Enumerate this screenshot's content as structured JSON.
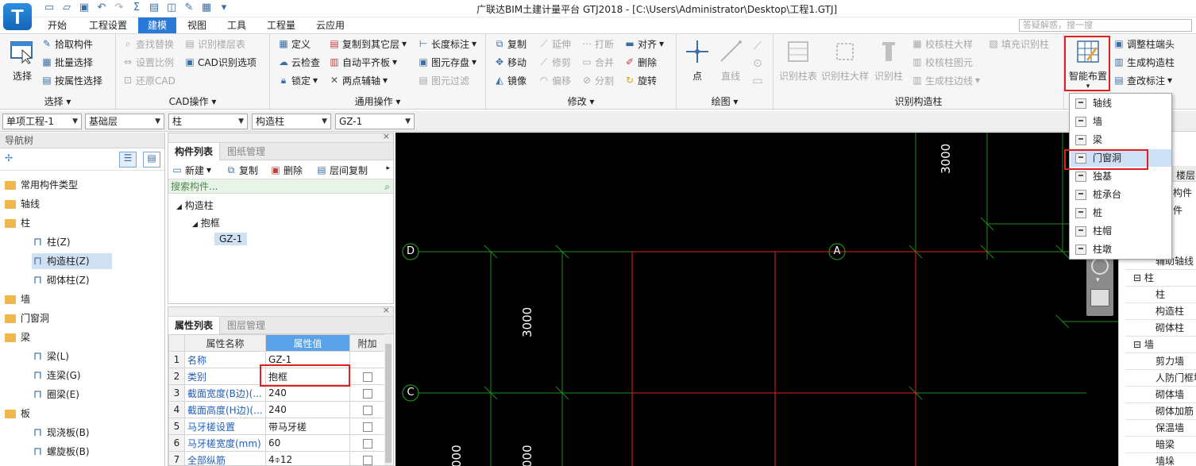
{
  "app": {
    "logo_letter": "T",
    "title": "广联达BIM土建计量平台 GTJ2018 - [C:\\Users\\Administrator\\Desktop\\工程1.GTJ]",
    "help_placeholder": "答疑解惑，搜一搜"
  },
  "tabs": [
    "开始",
    "工程设置",
    "建模",
    "视图",
    "工具",
    "工程量",
    "云应用"
  ],
  "active_tab": "建模",
  "ribbon": {
    "select": {
      "big_label": "选择",
      "items": [
        "拾取构件",
        "批量选择",
        "按属性选择"
      ],
      "group_label": "选择"
    },
    "cad": {
      "items": [
        "查找替换",
        "识别楼层表",
        "设置比例",
        "CAD识别选项",
        "还原CAD"
      ],
      "group_label": "CAD操作"
    },
    "general": {
      "items": [
        "定义",
        "复制到其它层",
        "长度标注",
        "云检查",
        "自动平齐板",
        "图元存盘",
        "锁定",
        "两点辅轴",
        "图元过滤"
      ],
      "group_label": "通用操作"
    },
    "modify": {
      "items": [
        "复制",
        "延伸",
        "打断",
        "对齐",
        "移动",
        "修剪",
        "合并",
        "删除",
        "镜像",
        "偏移",
        "分割",
        "旋转"
      ],
      "group_label": "修改"
    },
    "draw": {
      "items": [
        "点",
        "直线"
      ],
      "group_label": "绘图"
    },
    "recognize": {
      "items": [
        "识别柱表",
        "识别柱大样",
        "识别柱",
        "校核柱大样",
        "校核柱图元",
        "生成柱边线",
        "填充识别柱"
      ],
      "group_label": "识别构造柱"
    },
    "smart": {
      "big_label": "智能布置",
      "items": [
        "调整柱端头",
        "生成构造柱",
        "查改标注"
      ]
    }
  },
  "selectors": [
    "单项工程-1",
    "基础层",
    "柱",
    "构造柱",
    "GZ-1"
  ],
  "nav": {
    "header": "导航树",
    "items": [
      {
        "label": "常用构件类型",
        "level": 0
      },
      {
        "label": "轴线",
        "level": 0
      },
      {
        "label": "柱",
        "level": 0
      },
      {
        "label": "柱(Z)",
        "level": 1
      },
      {
        "label": "构造柱(Z)",
        "level": 1,
        "selected": true
      },
      {
        "label": "砌体柱(Z)",
        "level": 1
      },
      {
        "label": "墙",
        "level": 0
      },
      {
        "label": "门窗洞",
        "level": 0
      },
      {
        "label": "梁",
        "level": 0
      },
      {
        "label": "梁(L)",
        "level": 1
      },
      {
        "label": "连梁(G)",
        "level": 1
      },
      {
        "label": "圈梁(E)",
        "level": 1
      },
      {
        "label": "板",
        "level": 0
      },
      {
        "label": "现浇板(B)",
        "level": 1
      },
      {
        "label": "螺旋板(B)",
        "level": 1
      }
    ]
  },
  "component_list": {
    "tabs": [
      "构件列表",
      "图纸管理"
    ],
    "toolbar": [
      "新建",
      "复制",
      "删除",
      "层间复制"
    ],
    "search_placeholder": "搜索构件...",
    "tree": [
      "构造柱",
      "抱框",
      "GZ-1"
    ]
  },
  "property_list": {
    "tabs": [
      "属性列表",
      "图层管理"
    ],
    "headers": [
      "属性名称",
      "属性值",
      "附加"
    ],
    "rows": [
      {
        "num": "1",
        "name": "名称",
        "value": "GZ-1"
      },
      {
        "num": "2",
        "name": "类别",
        "value": "抱框"
      },
      {
        "num": "3",
        "name": "截面宽度(B边)(...",
        "value": "240"
      },
      {
        "num": "4",
        "name": "截面高度(H边)(...",
        "value": "240"
      },
      {
        "num": "5",
        "name": "马牙槎设置",
        "value": "带马牙槎"
      },
      {
        "num": "6",
        "name": "马牙槎宽度(mm)",
        "value": "60"
      },
      {
        "num": "7",
        "name": "全部纵筋",
        "value": "4⌽12"
      }
    ]
  },
  "canvas": {
    "axis_labels": [
      "D",
      "A",
      "C"
    ],
    "dimension_labels": [
      "3000",
      "3000",
      "000",
      "000"
    ]
  },
  "smart_menu": {
    "items": [
      "轴线",
      "墙",
      "梁",
      "门窗洞",
      "独基",
      "桩承台",
      "桩",
      "柱帽",
      "柱墩"
    ],
    "highlighted": "门窗洞"
  },
  "right_panel": {
    "tabs_partial": [
      "楼层",
      "构件",
      "件"
    ],
    "items": [
      "辅助轴线",
      "柱",
      "柱",
      "构造柱",
      "砌体柱",
      "墙",
      "剪力墙",
      "人防门框墙",
      "砌体墙",
      "砌体加筋",
      "保温墙",
      "暗梁",
      "墙垛"
    ]
  },
  "colors": {
    "ribbon_active_tab": "#2b79d6",
    "canvas_bg": "#000000",
    "grid_green": "#1f8c1f",
    "grid_red": "#e02020",
    "highlight_box": "#e02020"
  }
}
